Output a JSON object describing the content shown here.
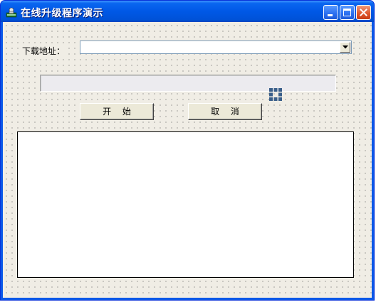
{
  "window": {
    "title": "在线升级程序演示",
    "colors": {
      "titlebar": "#0058e6",
      "close": "#e05a30",
      "client": "#f0ede5"
    }
  },
  "titlebar_buttons": {
    "minimize_icon": "minimize-icon",
    "maximize_icon": "maximize-icon",
    "close_icon": "close-icon"
  },
  "form": {
    "download_label": "下载地址：",
    "download_url": "",
    "progress_percent": 0,
    "start_label": "开 始",
    "cancel_label": "取 消",
    "log_text": ""
  }
}
